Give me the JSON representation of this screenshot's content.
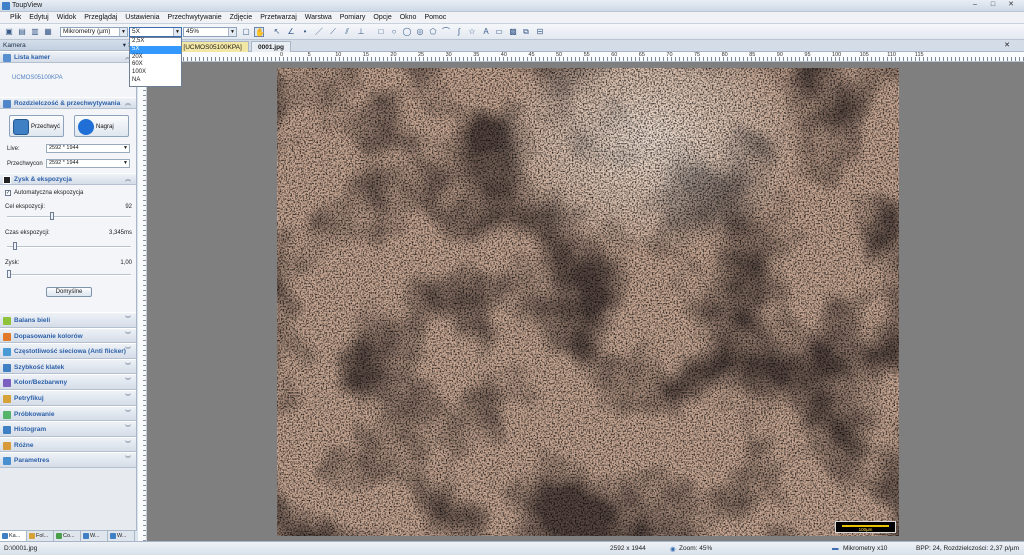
{
  "window": {
    "title": "ToupView"
  },
  "menu": [
    "Plik",
    "Edytuj",
    "Widok",
    "Przeglądaj",
    "Ustawienia",
    "Przechwytywanie",
    "Zdjęcie",
    "Przetwarzaj",
    "Warstwa",
    "Pomiary",
    "Opcje",
    "Okno",
    "Pomoc"
  ],
  "toolbar": {
    "unit_select": "Mikrometry (µm)",
    "magnification_select": "5X",
    "zoom_select": "45%"
  },
  "magnification_options": [
    "2,5X",
    "5X",
    "20X",
    "60X",
    "100X",
    "NA"
  ],
  "magnification_selected_index": 1,
  "left_panel": {
    "title": "Kamera",
    "camera_list": {
      "header": "Lista kamer",
      "item": "UCMOS05100KPA"
    },
    "resolution": {
      "header": "Rozdzielczość & przechwytywania",
      "capture_label": "Przechwyć",
      "record_label": "Nagraj",
      "live_label": "Live:",
      "live_value": "2592 * 1944",
      "capture_res_label": "Przechwycon",
      "capture_res_value": "2592 * 1944"
    },
    "exposure": {
      "header": "Zysk & ekspozycja",
      "auto_label": "Automatyczna ekspozycja",
      "auto_checked": true,
      "target_label": "Cel ekspozycji:",
      "target_value": "92",
      "target_fraction": 0.36,
      "time_label": "Czas ekspozycji:",
      "time_value": "3,345ms",
      "time_fraction": 0.05,
      "gain_label": "Zysk:",
      "gain_value": "1,00",
      "gain_fraction": 0.0,
      "default_label": "Domyślne"
    },
    "collapsed_sections": [
      "Balans bieli",
      "Dopasowanie kolorów",
      "Częstotliwość sieciowa (Anti flicker)",
      "Szybkość klatek",
      "Kolor/Bezbarwny",
      "Petryfikuj",
      "Próbkowanie",
      "Histogram",
      "Różne",
      "Parametres"
    ],
    "bottom_tabs": [
      "Ka...",
      "Fol...",
      "Co...",
      "W...",
      "W..."
    ]
  },
  "doc_tabs": {
    "camera_tab": "o [UCMOS05100KPA]",
    "file_tab": "0001.jpg"
  },
  "ruler_labels": [
    "0",
    "5",
    "10",
    "15",
    "20",
    "25",
    "30",
    "35",
    "40",
    "45",
    "50",
    "55",
    "60",
    "65",
    "70",
    "75",
    "80",
    "85",
    "90",
    "95",
    "100",
    "105",
    "110",
    "115"
  ],
  "scale_bar": {
    "label": "100µm"
  },
  "status": {
    "path": "D:\\0001.jpg",
    "dimensions": "2592 x 1944",
    "zoom": "Zoom: 45%",
    "unit": "Mikrometry x10",
    "bpp": "BPP: 24, Rozdzielczości: 2,37 p/µm"
  },
  "colors": {
    "accent": "#2b5fa8",
    "selection": "#3399ff",
    "active_tab": "#f3e7a5"
  }
}
